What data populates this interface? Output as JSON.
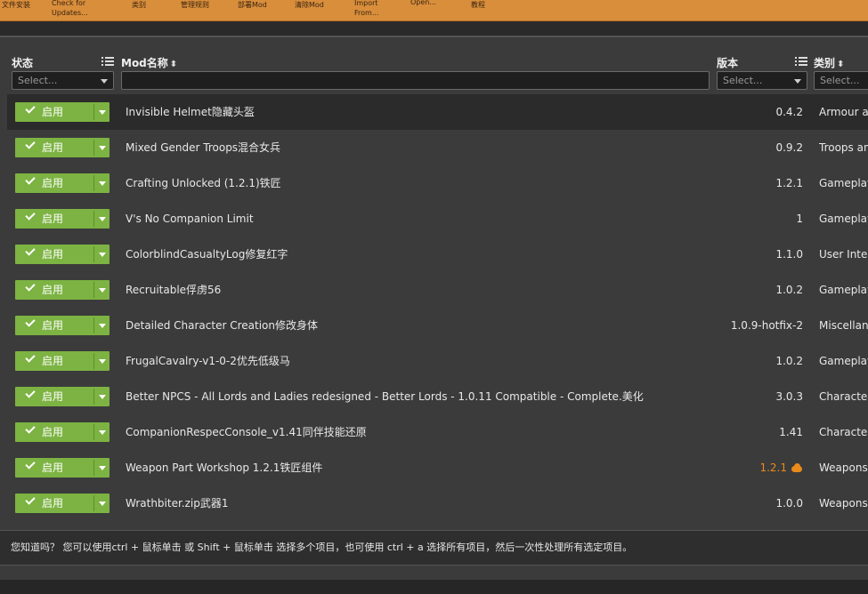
{
  "toolbar": {
    "items": [
      "文件安装",
      "Check for Updates...",
      "类别",
      "管理规则",
      "部署Mod",
      "清除Mod",
      "Import From...",
      "Open...",
      "教程"
    ]
  },
  "table": {
    "headers": {
      "status": "状态",
      "name": "Mod名称",
      "version": "版本",
      "category": "类别"
    },
    "filters": {
      "status_placeholder": "Select...",
      "version_placeholder": "Select...",
      "category_placeholder": "Select..."
    },
    "enabled_label": "启用",
    "rows": [
      {
        "name": "Invisible Helmet隐藏头盔",
        "version": "0.4.2",
        "category": "Armour ar",
        "update": false
      },
      {
        "name": "Mixed Gender Troops混合女兵",
        "version": "0.9.2",
        "category": "Troops an",
        "update": false
      },
      {
        "name": "Crafting Unlocked (1.2.1)铁匠",
        "version": "1.2.1",
        "category": "Gameplay",
        "update": false
      },
      {
        "name": "V's No Companion Limit",
        "version": "1",
        "category": "Gameplay",
        "update": false
      },
      {
        "name": "ColorblindCasualtyLog修复红字",
        "version": "1.1.0",
        "category": "User Inter",
        "update": false
      },
      {
        "name": "Recruitable俘虏56",
        "version": "1.0.2",
        "category": "Gameplay",
        "update": false
      },
      {
        "name": "Detailed Character Creation修改身体",
        "version": "1.0.9-hotfix-2",
        "category": "Miscellan",
        "update": false
      },
      {
        "name": "FrugalCavalry-v1-0-2优先低级马",
        "version": "1.0.2",
        "category": "Gameplay",
        "update": false
      },
      {
        "name": "Better NPCS - All Lords and Ladies redesigned - Better Lords - 1.0.11 Compatible - Complete.美化",
        "version": "3.0.3",
        "category": "Character",
        "update": false
      },
      {
        "name": "CompanionRespecConsole_v1.41同伴技能还原",
        "version": "1.41",
        "category": "Character",
        "update": false
      },
      {
        "name": "Weapon Part Workshop 1.2.1铁匠组件",
        "version": "1.2.1",
        "category": "Weapons",
        "update": true
      },
      {
        "name": "Wrathbiter.zip武器1",
        "version": "1.0.0",
        "category": "Weapons",
        "update": false
      }
    ]
  },
  "tip": "您知道吗？ 您可以使用ctrl + 鼠标单击 或 Shift + 鼠标单击 选择多个项目，也可使用 ctrl + a 选择所有项目，然后一次性处理所有选定项目。",
  "colors": {
    "toolbar": "#d98e3b",
    "enabled_button": "#7cb342",
    "update_version": "#e98b1d"
  },
  "icons": [
    "check-icon",
    "chevron-down-icon",
    "sort-icon",
    "column-list-icon",
    "cloud-download-icon"
  ]
}
